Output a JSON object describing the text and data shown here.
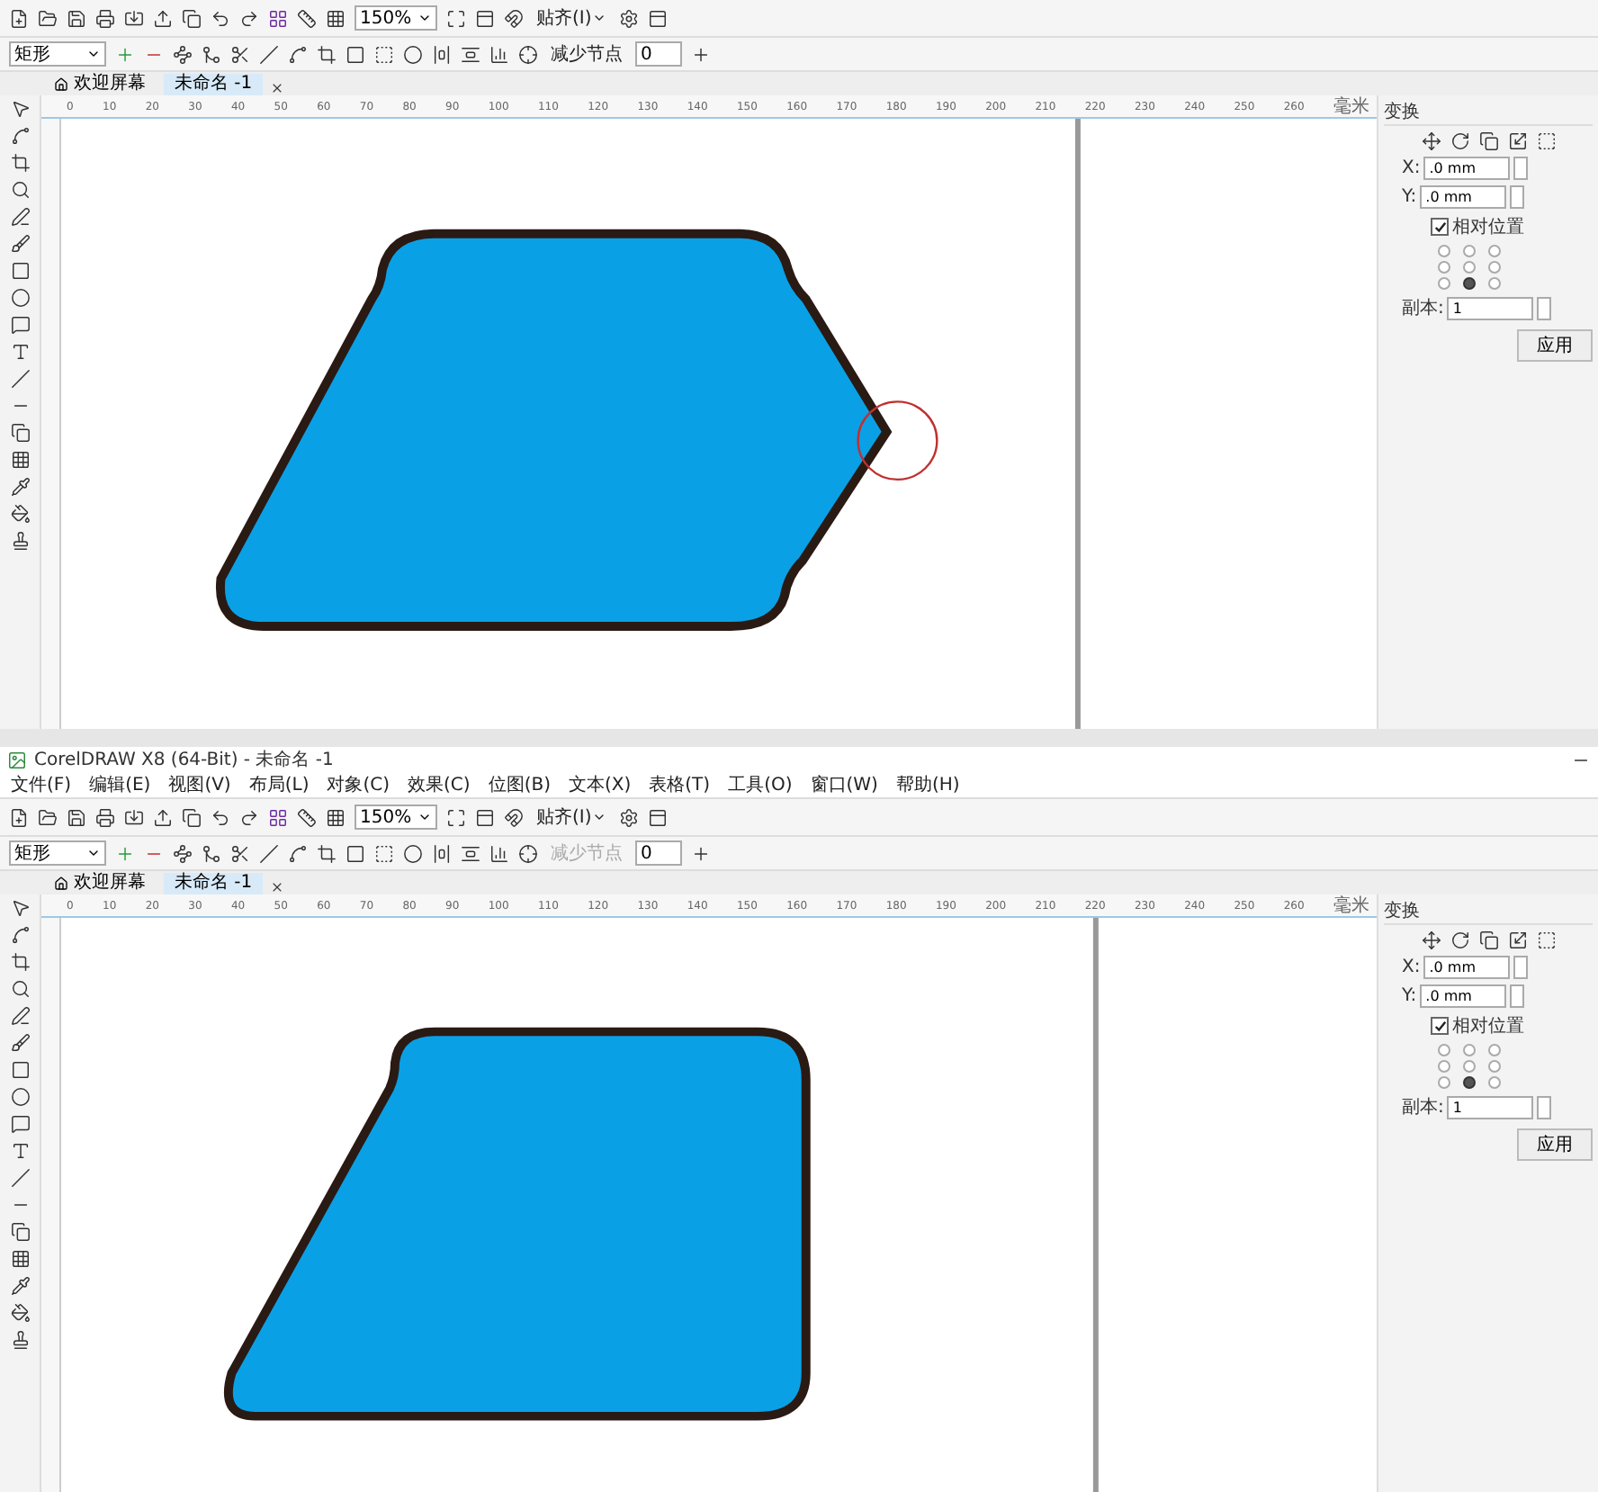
{
  "panels": [
    {
      "toolbar": {
        "zoom": "150%",
        "snap": "贴齐(I)"
      },
      "property_bar": {
        "shape_type": "矩形",
        "reduce_nodes": {
          "label": "减少节点",
          "disabled": false
        },
        "smoothness": "0"
      },
      "tabs": [
        {
          "label": "欢迎屏幕",
          "selected": false
        },
        {
          "label": "未命名 -1",
          "selected": true
        }
      ],
      "ruler": [
        "0",
        "10",
        "20",
        "30",
        "40",
        "50",
        "60",
        "70",
        "80",
        "90",
        "100",
        "110",
        "120",
        "130",
        "140",
        "150",
        "160",
        "170",
        "180",
        "190",
        "200",
        "210",
        "220",
        "230",
        "240",
        "250",
        "260",
        "毫米"
      ],
      "canvas": {
        "kind": "pointed",
        "node_highlighted": true
      },
      "docker": {
        "title": "变换",
        "x": ".0 mm",
        "y": ".0 mm",
        "x_label": "X:",
        "y_label": "Y:",
        "relative_position": {
          "label": "相对位置",
          "checked": true
        },
        "anchors": [
          {
            "selected": false
          },
          {
            "selected": false
          },
          {
            "selected": false
          },
          {
            "selected": false
          },
          {
            "selected": false
          },
          {
            "selected": false
          },
          {
            "selected": false
          },
          {
            "selected": true
          },
          {
            "selected": false
          }
        ],
        "copies_label": "副本:",
        "copies": "1",
        "apply": "应用"
      }
    },
    {
      "title_bar": {
        "title": "CorelDRAW X8 (64-Bit) - 未命名 -1"
      },
      "menu": [
        "文件(F)",
        "编辑(E)",
        "视图(V)",
        "布局(L)",
        "对象(C)",
        "效果(C)",
        "位图(B)",
        "文本(X)",
        "表格(T)",
        "工具(O)",
        "窗口(W)",
        "帮助(H)"
      ],
      "toolbar": {
        "zoom": "150%",
        "snap": "贴齐(I)"
      },
      "property_bar": {
        "shape_type": "矩形",
        "reduce_nodes": {
          "label": "减少节点",
          "disabled": true
        },
        "smoothness": "0"
      },
      "tabs": [
        {
          "label": "欢迎屏幕",
          "selected": false
        },
        {
          "label": "未命名 -1",
          "selected": true
        }
      ],
      "ruler": [
        "0",
        "10",
        "20",
        "30",
        "40",
        "50",
        "60",
        "70",
        "80",
        "90",
        "100",
        "110",
        "120",
        "130",
        "140",
        "150",
        "160",
        "170",
        "180",
        "190",
        "200",
        "210",
        "220",
        "230",
        "240",
        "250",
        "260",
        "毫米"
      ],
      "canvas": {
        "kind": "flat"
      },
      "docker": {
        "title": "变换",
        "x": ".0 mm",
        "y": ".0 mm",
        "x_label": "X:",
        "y_label": "Y:",
        "relative_position": {
          "label": "相对位置",
          "checked": true
        },
        "anchors": [
          {
            "selected": false
          },
          {
            "selected": false
          },
          {
            "selected": false
          },
          {
            "selected": false
          },
          {
            "selected": false
          },
          {
            "selected": false
          },
          {
            "selected": false
          },
          {
            "selected": true
          },
          {
            "selected": false
          }
        ],
        "copies_label": "副本:",
        "copies": "1",
        "apply": "应用"
      }
    }
  ]
}
